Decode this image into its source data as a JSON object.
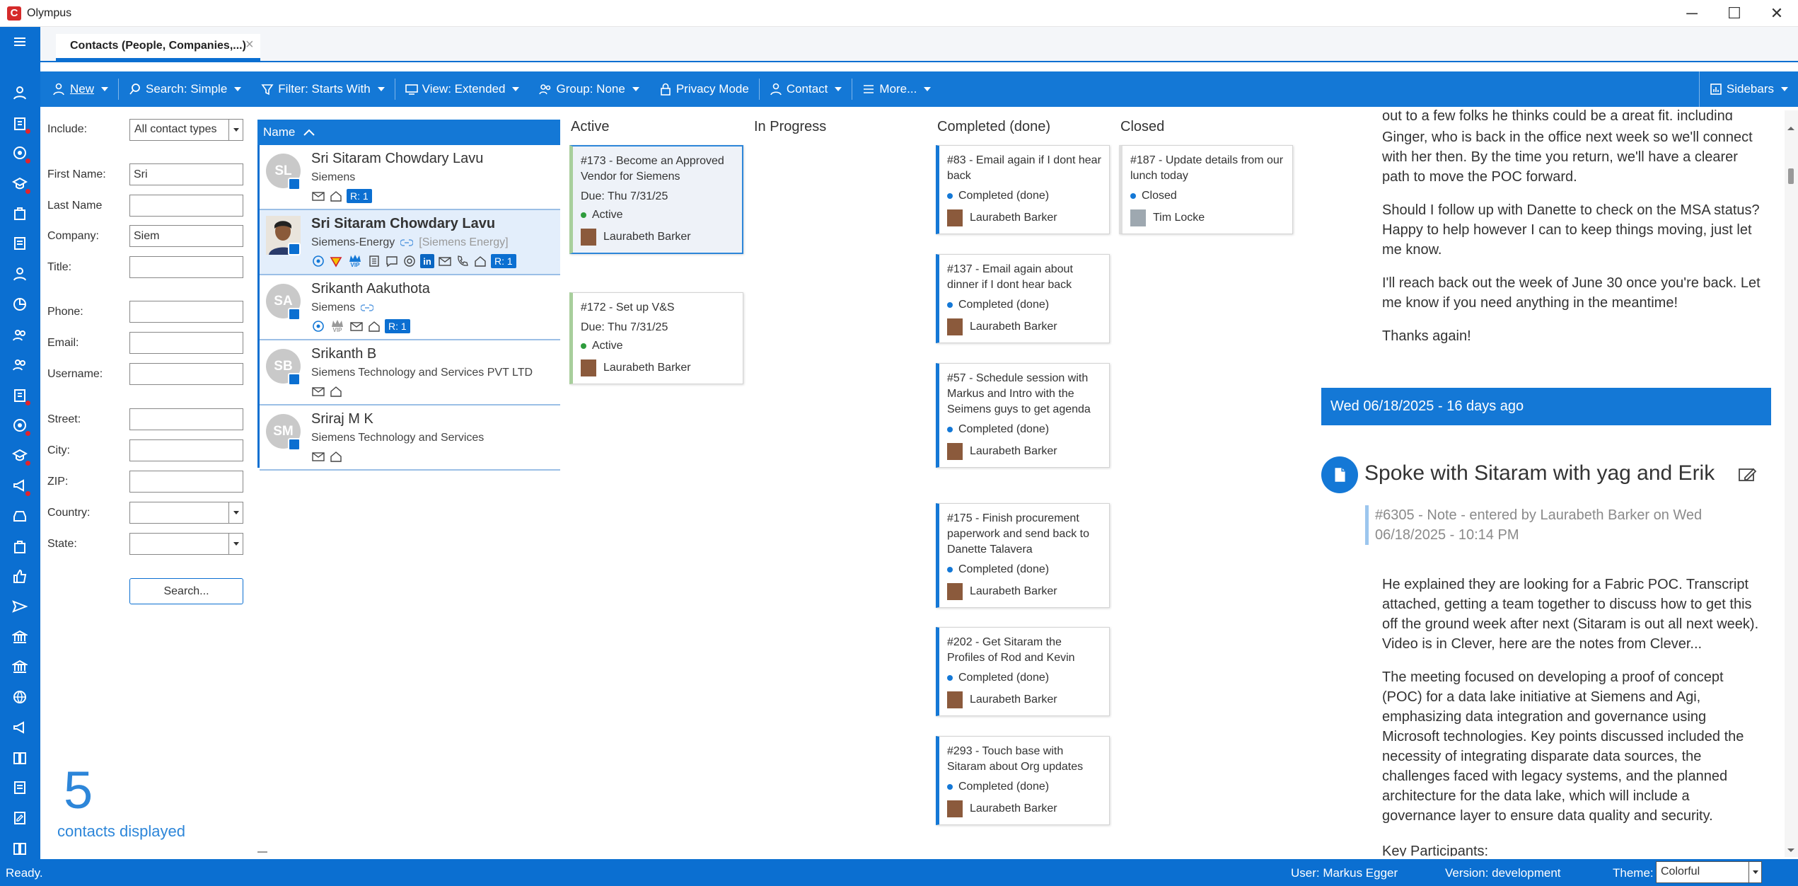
{
  "window": {
    "app_logo": "C",
    "title": "Olympus",
    "minimize_glyph": "─",
    "maximize_glyph": "☐",
    "close_glyph": "✕"
  },
  "tab": {
    "label": "Contacts (People, Companies,...)",
    "close_glyph": "×"
  },
  "toolbar": {
    "new": "New",
    "search": "Search: Simple",
    "filter": "Filter: Starts With",
    "view": "View: Extended",
    "group": "Group: None",
    "privacy": "Privacy Mode",
    "contact": "Contact",
    "more": "More...",
    "sidebars": "Sidebars"
  },
  "form": {
    "include_label": "Include:",
    "include_value": "All contact types",
    "first_name_label": "First Name:",
    "first_name_value": "Sri",
    "last_name_label": "Last Name",
    "last_name_value": "",
    "company_label": "Company:",
    "company_value": "Siem",
    "title_label": "Title:",
    "title_value": "",
    "phone_label": "Phone:",
    "phone_value": "",
    "email_label": "Email:",
    "email_value": "",
    "username_label": "Username:",
    "username_value": "",
    "street_label": "Street:",
    "street_value": "",
    "city_label": "City:",
    "city_value": "",
    "zip_label": "ZIP:",
    "zip_value": "",
    "country_label": "Country:",
    "country_value": "",
    "state_label": "State:",
    "state_value": "",
    "search_button": "Search..."
  },
  "count": {
    "number": "5",
    "label": "contacts displayed"
  },
  "list": {
    "header": "Name",
    "rows": [
      {
        "initials": "SL",
        "name": "Sri Sitaram Chowdary Lavu",
        "company": "Siemens",
        "badge": "R: 1"
      },
      {
        "initials": "",
        "name": "Sri Sitaram Chowdary Lavu",
        "company": "Siemens-Energy",
        "alias": "[Siemens Energy]",
        "badge": "R: 1",
        "vip": "VIP",
        "linkedin": "in"
      },
      {
        "initials": "SA",
        "name": "Srikanth Aakuthota",
        "company": "Siemens",
        "badge": "R: 1",
        "vip": "VIP"
      },
      {
        "initials": "SB",
        "name": "Srikanth B",
        "company": "Siemens Technology and Services PVT LTD"
      },
      {
        "initials": "SM",
        "name": "Sriraj M K",
        "company": "Siemens Technology and Services"
      }
    ]
  },
  "kanban": {
    "columns": [
      "Active",
      "In Progress",
      "Completed (done)",
      "Closed"
    ],
    "active": [
      {
        "title": "#173 - Become an Approved Vendor for Siemens",
        "due": "Due: Thu 7/31/25",
        "status": "Active",
        "person": "Laurabeth Barker"
      },
      {
        "title": "#172 - Set up V&S",
        "due": "Due: Thu 7/31/25",
        "status": "Active",
        "person": "Laurabeth Barker"
      }
    ],
    "completed": [
      {
        "title": "#83 - Email again if I dont hear back",
        "status": "Completed (done)",
        "person": "Laurabeth Barker"
      },
      {
        "title": "#137 - Email again about dinner if I dont hear back",
        "status": "Completed (done)",
        "person": "Laurabeth Barker"
      },
      {
        "title": "#57 - Schedule session with Markus and Intro with the Seimens guys to get agenda",
        "status": "Completed (done)",
        "person": "Laurabeth Barker"
      },
      {
        "title": "#175 - Finish procurement paperwork and send back to Danette Talavera",
        "status": "Completed (done)",
        "person": "Laurabeth Barker"
      },
      {
        "title": "#202 - Get Sitaram the Profiles of Rod and Kevin",
        "status": "Completed (done)",
        "person": "Laurabeth Barker"
      },
      {
        "title": "#293 - Touch base with Sitaram about Org updates",
        "status": "Completed (done)",
        "person": "Laurabeth Barker"
      }
    ],
    "closed": [
      {
        "title": "#187 - Update details from our lunch today",
        "status": "Closed",
        "person": "Tim Locke"
      }
    ]
  },
  "notes": {
    "para_top_cut": "out to a few folks he thinks could be a great fit, including",
    "para1": "Ginger, who is back in the office next week so we'll connect with her then. By the time you return, we'll have a clearer path to move the POC forward.",
    "para2": "Should I follow up with Danette to check on the MSA status? Happy to help however I can to keep things moving, just let me know.",
    "para3": "I'll reach back out the week of June 30 once you're back. Let me know if you need anything in the meantime!",
    "para4": "Thanks again!",
    "date_header": "Wed 06/18/2025 - 16 days ago",
    "note_title": "Spoke with Sitaram with yag and Erik",
    "note_meta": "#6305 - Note - entered by Laurabeth Barker on Wed 06/18/2025 - 10:14 PM",
    "body1": "He explained they are looking for a Fabric POC. Transcript attached, getting a team together to discuss how to get this off the ground week after next (Sitaram is out all next week). Video is in Clever, here are the notes from Clever...",
    "body2": "The meeting focused on developing a proof of concept (POC) for a data lake initiative at Siemens and Agi, emphasizing data integration and governance using Microsoft technologies. Key points discussed included the necessity of integrating disparate data sources, the challenges faced with legacy systems, and the planned architecture for the data lake, which will include a governance layer to ensure data quality and security.",
    "body3_cut": "Key Participants:"
  },
  "status": {
    "ready": "Ready.",
    "user": "User: Markus Egger",
    "version": "Version: development",
    "theme_label": "Theme:",
    "theme_value": "Colorful"
  },
  "colors": {
    "brand_blue": "#0b6fd1",
    "toolbar_blue": "#1478d6",
    "accent_red": "#d52b2b"
  }
}
